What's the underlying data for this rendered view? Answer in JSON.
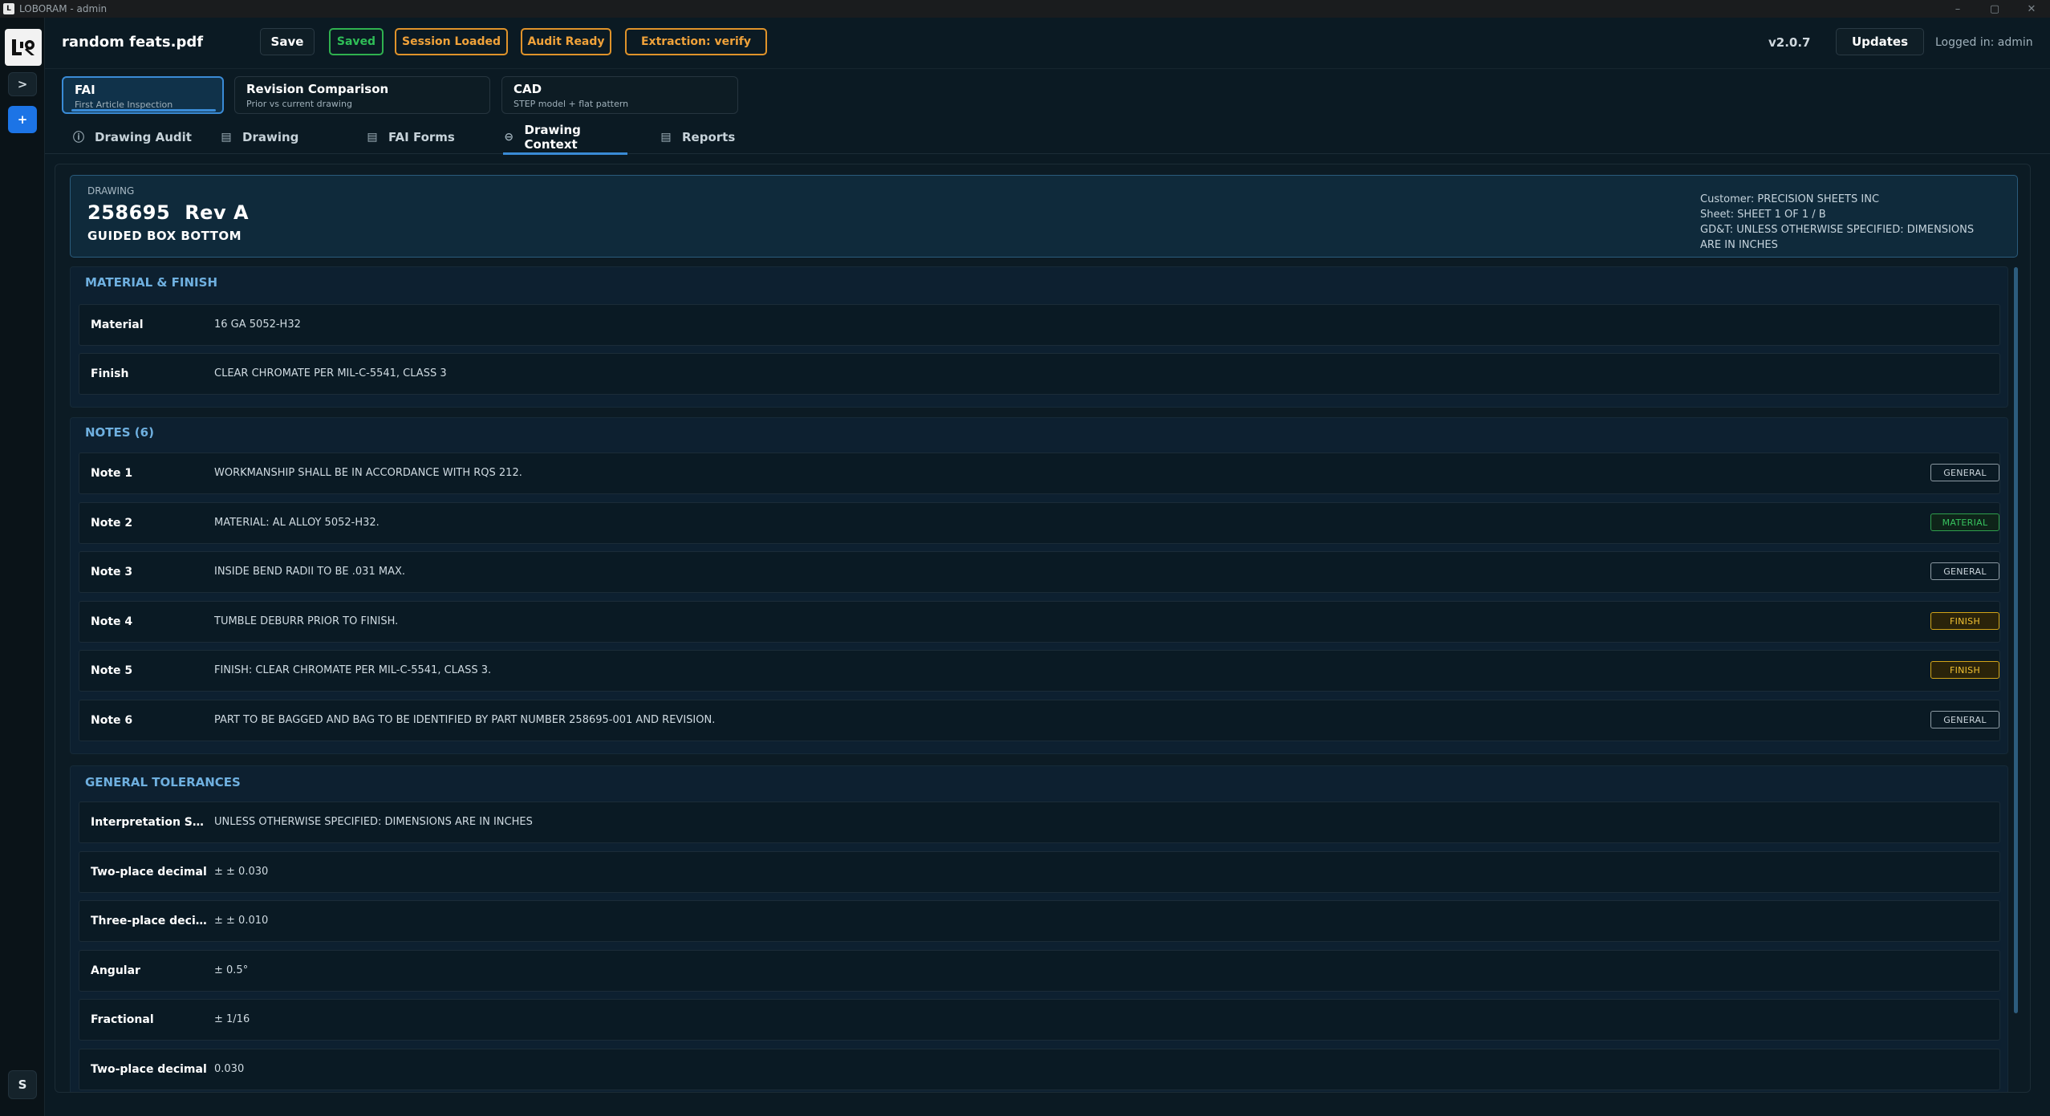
{
  "window": {
    "title": "LOBORAM - admin",
    "controls": {
      "minimize": "–",
      "maximize": "▢",
      "close": "✕"
    }
  },
  "rail": {
    "logo_alt": "LOBORAM logo",
    "expand_label": ">",
    "add_label": "+",
    "user_initial": "S"
  },
  "header": {
    "filename": "random feats.pdf",
    "save_label": "Save",
    "saved_badge": "Saved",
    "session_badge": "Session Loaded",
    "audit_badge": "Audit Ready",
    "extraction_badge": "Extraction: verify",
    "version": "v2.0.7",
    "updates_label": "Updates",
    "logged_in": "Logged in: admin"
  },
  "modules": [
    {
      "title": "FAI",
      "subtitle": "First Article Inspection",
      "active": true
    },
    {
      "title": "Revision Comparison",
      "subtitle": "Prior vs current drawing",
      "active": false
    },
    {
      "title": "CAD",
      "subtitle": "STEP model + flat pattern",
      "active": false
    }
  ],
  "tabs": [
    {
      "label": "Drawing Audit",
      "icon": "info-icon",
      "active": false
    },
    {
      "label": "Drawing",
      "icon": "document-icon",
      "active": false
    },
    {
      "label": "FAI Forms",
      "icon": "form-icon",
      "active": false
    },
    {
      "label": "Drawing Context",
      "icon": "context-icon",
      "active": true
    },
    {
      "label": "Reports",
      "icon": "report-icon",
      "active": false
    }
  ],
  "drawing": {
    "label": "DRAWING",
    "number": "258695",
    "revision": "Rev A",
    "title": "GUIDED BOX BOTTOM",
    "customer": "Customer: PRECISION SHEETS INC",
    "sheet": "Sheet: SHEET 1 OF 1 / B",
    "gdt": "GD&T: UNLESS OTHERWISE SPECIFIED: DIMENSIONS ARE IN INCHES"
  },
  "material_finish": {
    "title": "MATERIAL & FINISH",
    "rows": [
      {
        "label": "Material",
        "value": "16 GA 5052-H32"
      },
      {
        "label": "Finish",
        "value": "CLEAR CHROMATE PER MIL-C-5541, CLASS 3"
      }
    ]
  },
  "notes": {
    "title": "NOTES (6)",
    "rows": [
      {
        "label": "Note 1",
        "value": "WORKMANSHIP SHALL BE IN ACCORDANCE WITH RQS 212.",
        "tag": "GENERAL",
        "tag_type": "general"
      },
      {
        "label": "Note 2",
        "value": "MATERIAL: AL ALLOY 5052-H32.",
        "tag": "MATERIAL",
        "tag_type": "material"
      },
      {
        "label": "Note 3",
        "value": "INSIDE BEND RADII TO BE .031 MAX.",
        "tag": "GENERAL",
        "tag_type": "general"
      },
      {
        "label": "Note 4",
        "value": "TUMBLE DEBURR PRIOR TO FINISH.",
        "tag": "FINISH",
        "tag_type": "finish"
      },
      {
        "label": "Note 5",
        "value": "FINISH: CLEAR CHROMATE PER MIL-C-5541, CLASS 3.",
        "tag": "FINISH",
        "tag_type": "finish"
      },
      {
        "label": "Note 6",
        "value": "PART TO BE BAGGED AND BAG TO BE IDENTIFIED BY PART NUMBER 258695-001 AND REVISION.",
        "tag": "GENERAL",
        "tag_type": "general"
      }
    ]
  },
  "tolerances": {
    "title": "GENERAL TOLERANCES",
    "rows": [
      {
        "label": "Interpretation Stan...",
        "value": "UNLESS OTHERWISE SPECIFIED: DIMENSIONS ARE IN INCHES"
      },
      {
        "label": "Two-place decimal",
        "value": "± ± 0.030"
      },
      {
        "label": "Three-place decimal",
        "value": "± ± 0.010"
      },
      {
        "label": "Angular",
        "value": "± 0.5°"
      },
      {
        "label": "Fractional",
        "value": "± 1/16"
      },
      {
        "label": "Two-place decimal",
        "value": "0.030"
      }
    ]
  },
  "colors": {
    "accent": "#3a8bd6",
    "saved": "#2fbe57",
    "warning": "#f0a23a",
    "material_tag": "#37c35f",
    "finish_tag": "#f1c232"
  }
}
